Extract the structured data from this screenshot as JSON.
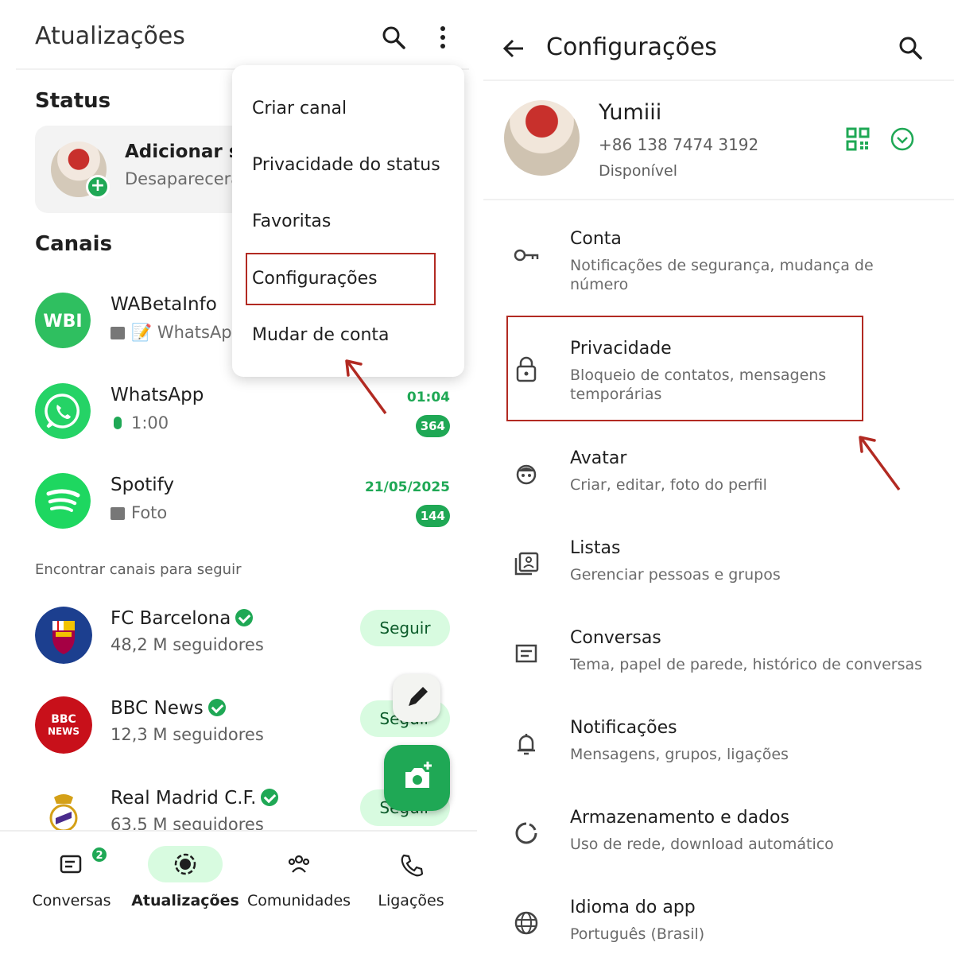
{
  "left": {
    "title": "Atualizações",
    "status_heading": "Status",
    "status_card": {
      "title": "Adicionar status",
      "subtitle": "Desaparecerá após 24 horas"
    },
    "channels_heading": "Canais",
    "channels": [
      {
        "name": "WABetaInfo",
        "preview": "📝 WhatsApp",
        "time": "",
        "badge": "",
        "avatar_text": "WBI"
      },
      {
        "name": "WhatsApp",
        "preview": "1:00",
        "time": "01:04",
        "badge": "364"
      },
      {
        "name": "Spotify",
        "preview": "Foto",
        "time": "21/05/2025",
        "badge": "144"
      }
    ],
    "find_heading": "Encontrar canais para seguir",
    "suggestions": [
      {
        "name": "FC Barcelona",
        "followers": "48,2 M seguidores",
        "button": "Seguir"
      },
      {
        "name": "BBC News",
        "followers": "12,3 M seguidores",
        "button": "Seguir",
        "avatar_text_1": "BBC",
        "avatar_text_2": "NEWS"
      },
      {
        "name": "Real Madrid C.F.",
        "followers": "63,5 M seguidores",
        "button": "Seguir"
      }
    ],
    "nav": [
      {
        "label": "Conversas",
        "badge": "2"
      },
      {
        "label": "Atualizações"
      },
      {
        "label": "Comunidades"
      },
      {
        "label": "Ligações"
      }
    ],
    "menu": [
      "Criar canal",
      "Privacidade do status",
      "Favoritas",
      "Configurações",
      "Mudar de conta"
    ]
  },
  "right": {
    "title": "Configurações",
    "profile": {
      "name": "Yumiii",
      "phone": "+86 138 7474 3192",
      "status": "Disponível"
    },
    "settings": [
      {
        "title": "Conta",
        "subtitle": "Notificações de segurança, mudança de número",
        "icon": "key-icon"
      },
      {
        "title": "Privacidade",
        "subtitle": "Bloqueio de contatos, mensagens temporárias",
        "icon": "lock-icon"
      },
      {
        "title": "Avatar",
        "subtitle": "Criar, editar, foto do perfil",
        "icon": "avatar-icon"
      },
      {
        "title": "Listas",
        "subtitle": "Gerenciar pessoas e grupos",
        "icon": "lists-icon"
      },
      {
        "title": "Conversas",
        "subtitle": "Tema, papel de parede, histórico de conversas",
        "icon": "chat-icon"
      },
      {
        "title": "Notificações",
        "subtitle": "Mensagens, grupos, ligações",
        "icon": "bell-icon"
      },
      {
        "title": "Armazenamento e dados",
        "subtitle": "Uso de rede, download automático",
        "icon": "storage-icon"
      },
      {
        "title": "Idioma do app",
        "subtitle": "Português (Brasil)",
        "icon": "globe-icon"
      }
    ]
  },
  "colors": {
    "accent": "#1fa855",
    "highlight_box": "#b22a22",
    "pill_bg": "#d8fbe0"
  }
}
